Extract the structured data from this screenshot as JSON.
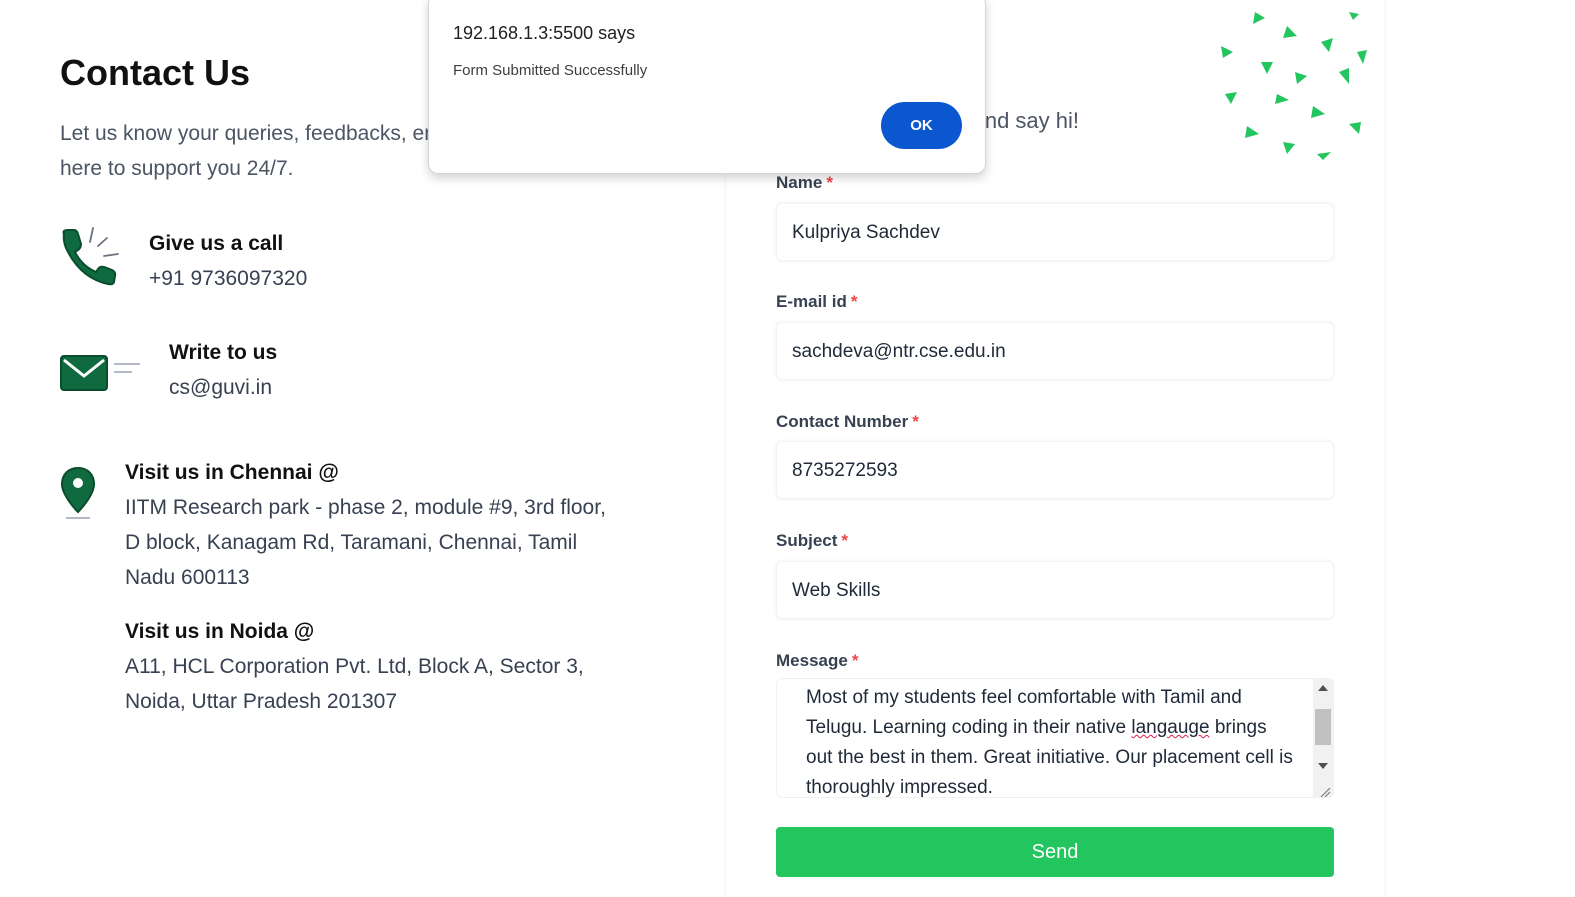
{
  "contact": {
    "title": "Contact Us",
    "intro": "Let us know your queries, feedbacks, enquiries. We are here to support you 24/7.",
    "call": {
      "title": "Give us a call",
      "value": "+91 9736097320"
    },
    "write": {
      "title": "Write to us",
      "value": "cs@guvi.in"
    },
    "chennai": {
      "title": "Visit us in Chennai @",
      "address": "IITM Research park - phase 2, module #9, 3rd floor, D block, Kanagam Rd, Taramani, Chennai, Tamil Nadu 600113"
    },
    "noida": {
      "title": "Visit us in Noida @",
      "address": "A11, HCL Corporation Pvt. Ltd, Block A, Sector 3, Noida, Uttar Pradesh 201307"
    }
  },
  "form": {
    "subtitle": "nd say hi!",
    "required_mark": "*",
    "fields": {
      "name": {
        "label": "Name",
        "value": "Kulpriya Sachdev"
      },
      "email": {
        "label": "E-mail id",
        "value": "sachdeva@ntr.cse.edu.in"
      },
      "phone": {
        "label": "Contact Number",
        "value": "8735272593"
      },
      "subject": {
        "label": "Subject",
        "value": "Web Skills"
      },
      "message": {
        "label": "Message",
        "text_before": "Most of my students feel comfortable with Tamil and Telugu. Learning coding in their native ",
        "misspelled": "langauge",
        "text_after": " brings out the best in them. Great initiative. Our placement cell is thoroughly impressed."
      }
    },
    "send_label": "Send",
    "colors": {
      "accent": "#22c55e",
      "brand": "#0f6b3f",
      "required": "#ef4444"
    }
  },
  "dialog": {
    "title": "192.168.1.3:5500 says",
    "message": "Form Submitted Successfully",
    "ok_label": "OK",
    "button_color": "#0b57d0"
  }
}
